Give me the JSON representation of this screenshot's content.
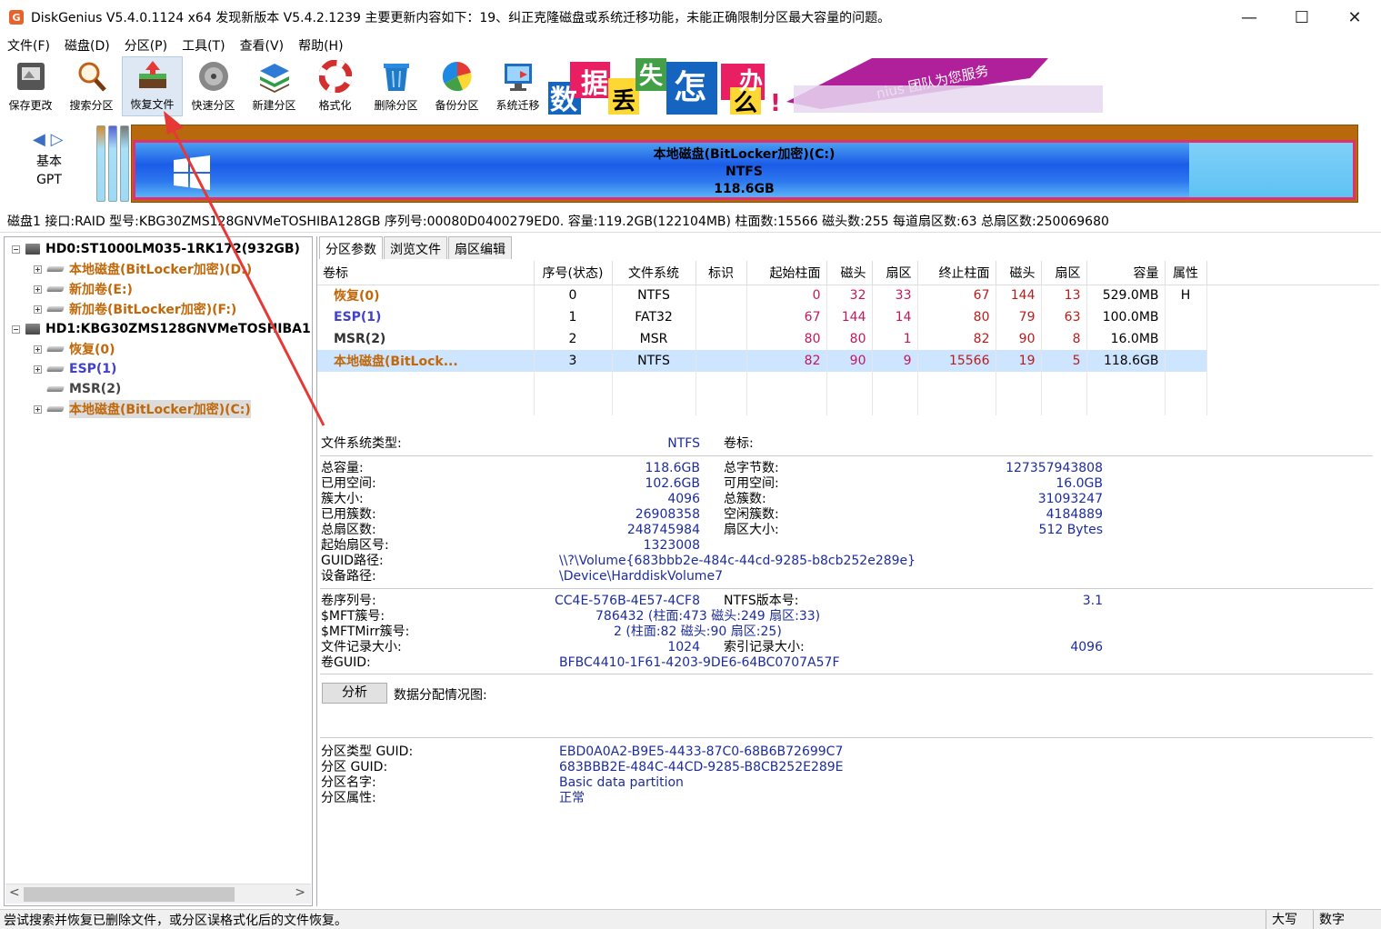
{
  "title": "DiskGenius V5.4.0.1124 x64   发现新版本 V5.4.2.1239 主要更新内容如下：19、纠正克隆磁盘或系统迁移功能，未能正确限制分区最大容量的问题。",
  "app_icon_letter": "G",
  "window_controls": {
    "minimize": "—",
    "maximize": "☐",
    "close": "✕"
  },
  "menu": [
    "文件(F)",
    "磁盘(D)",
    "分区(P)",
    "工具(T)",
    "查看(V)",
    "帮助(H)"
  ],
  "toolbar": [
    {
      "label": "保存更改",
      "icon": "save-icon"
    },
    {
      "label": "搜索分区",
      "icon": "search-icon"
    },
    {
      "label": "恢复文件",
      "icon": "recover-icon"
    },
    {
      "label": "快速分区",
      "icon": "disk-icon"
    },
    {
      "label": "新建分区",
      "icon": "layers-icon"
    },
    {
      "label": "格式化",
      "icon": "format-icon"
    },
    {
      "label": "删除分区",
      "icon": "trash-icon"
    },
    {
      "label": "备份分区",
      "icon": "backup-icon"
    },
    {
      "label": "系统迁移",
      "icon": "migrate-icon"
    }
  ],
  "banner": {
    "chars": [
      "数",
      "据",
      "丢",
      "失",
      "怎",
      "么",
      "办",
      "!"
    ],
    "slogan": "nius 团队为您服务"
  },
  "disk_map": {
    "arrows": "◀ ▷",
    "type_line1": "基本",
    "type_line2": "GPT",
    "partition_name": "本地磁盘(BitLocker加密)(C:)",
    "partition_fs": "NTFS",
    "partition_size": "118.6GB",
    "colors": {
      "border": "#e0306e",
      "body": "#1b5ce8",
      "free": "#5fc2f4"
    }
  },
  "disk_info": "磁盘1 接口:RAID  型号:KBG30ZMS128GNVMeTOSHIBA128GB  序列号:00080D0400279ED0.  容量:119.2GB(122104MB)  柱面数:15566  磁头数:255  每道扇区数:63  总扇区数:250069680",
  "tree": {
    "disks": [
      {
        "label": "HD0:ST1000LM035-1RK172(932GB)",
        "toggle": "−",
        "partitions": [
          {
            "label": "本地磁盘(BitLocker加密)(D:)",
            "color": "#c0680a",
            "toggle": "+"
          },
          {
            "label": "新加卷(E:)",
            "color": "#c0680a",
            "toggle": "+"
          },
          {
            "label": "新加卷(BitLocker加密)(F:)",
            "color": "#c0680a",
            "toggle": "+"
          }
        ]
      },
      {
        "label": "HD1:KBG30ZMS128GNVMeTOSHIBA1",
        "toggle": "−",
        "partitions": [
          {
            "label": "恢复(0)",
            "color": "#c0680a",
            "toggle": "+"
          },
          {
            "label": "ESP(1)",
            "color": "#4242c8",
            "toggle": "+"
          },
          {
            "label": "MSR(2)",
            "color": "#444444",
            "toggle": ""
          },
          {
            "label": "本地磁盘(BitLocker加密)(C:)",
            "color": "#c0680a",
            "toggle": "+"
          }
        ]
      }
    ],
    "scroll_left": "<",
    "scroll_right": ">"
  },
  "tabs": [
    "分区参数",
    "浏览文件",
    "扇区编辑"
  ],
  "table": {
    "headers": [
      "卷标",
      "序号(状态)",
      "文件系统",
      "标识",
      "起始柱面",
      "磁头",
      "扇区",
      "终止柱面",
      "磁头",
      "扇区",
      "容量",
      "属性"
    ],
    "rows": [
      [
        "恢复(0)",
        "0",
        "NTFS",
        "",
        "0",
        "32",
        "33",
        "67",
        "144",
        "13",
        "529.0MB",
        "H"
      ],
      [
        "ESP(1)",
        "1",
        "FAT32",
        "",
        "67",
        "144",
        "14",
        "80",
        "79",
        "63",
        "100.0MB",
        ""
      ],
      [
        "MSR(2)",
        "2",
        "MSR",
        "",
        "80",
        "80",
        "1",
        "82",
        "90",
        "8",
        "16.0MB",
        ""
      ],
      [
        "本地磁盘(BitLock...",
        "3",
        "NTFS",
        "",
        "82",
        "90",
        "9",
        "15566",
        "19",
        "5",
        "118.6GB",
        ""
      ]
    ],
    "row_colors": [
      "#c0680a",
      "#4242c8",
      "#333333",
      "#c0680a"
    ],
    "selected_row": 3
  },
  "details": {
    "fs_type_label": "文件系统类型:",
    "fs_type": "NTFS",
    "vol_label_label": "卷标:",
    "total_label": "总容量:",
    "total": "118.6GB",
    "total_bytes_label": "总字节数:",
    "total_bytes": "127357943808",
    "used_label": "已用空间:",
    "used": "102.6GB",
    "free_label": "可用空间:",
    "free": "16.0GB",
    "cluster_label": "簇大小:",
    "cluster": "4096",
    "total_clusters_label": "总簇数:",
    "total_clusters": "31093247",
    "used_clusters_label": "已用簇数:",
    "used_clusters": "26908358",
    "free_clusters_label": "空闲簇数:",
    "free_clusters": "4184889",
    "total_sectors_label": "总扇区数:",
    "total_sectors": "248745984",
    "sector_size_label": "扇区大小:",
    "sector_size": "512 Bytes",
    "start_sector_label": "起始扇区号:",
    "start_sector": "1323008",
    "guid_path_label": "GUID路径:",
    "guid_path": "\\\\?\\Volume{683bbb2e-484c-44cd-9285-b8cb252e289e}",
    "device_path_label": "设备路径:",
    "device_path": "\\Device\\HarddiskVolume7",
    "serial_label": "卷序列号:",
    "serial": "CC4E-576B-4E57-4CF8",
    "ntfs_ver_label": "NTFS版本号:",
    "ntfs_ver": "3.1",
    "mft_label": "$MFT簇号:",
    "mft": "786432 (柱面:473 磁头:249 扇区:33)",
    "mftmirr_label": "$MFTMirr簇号:",
    "mftmirr": "2 (柱面:82 磁头:90 扇区:25)",
    "file_record_label": "文件记录大小:",
    "file_record": "1024",
    "index_record_label": "索引记录大小:",
    "index_record": "4096",
    "vol_guid_label": "卷GUID:",
    "vol_guid": "BFBC4410-1F61-4203-9DE6-64BC0707A57F",
    "analyze_button": "分析",
    "alloc_label": "数据分配情况图:",
    "ptype_guid_label": "分区类型 GUID:",
    "ptype_guid": "EBD0A0A2-B9E5-4433-87C0-68B6B72699C7",
    "pguid_label": "分区 GUID:",
    "pguid": "683BBB2E-484C-44CD-9285-B8CB252E289E",
    "pname_label": "分区名字:",
    "pname": "Basic data partition",
    "pattr_label": "分区属性:",
    "pattr": "正常"
  },
  "status": {
    "message": "尝试搜索并恢复已删除文件，或分区误格式化后的文件恢复。",
    "caps": "大写",
    "num": "数字"
  }
}
